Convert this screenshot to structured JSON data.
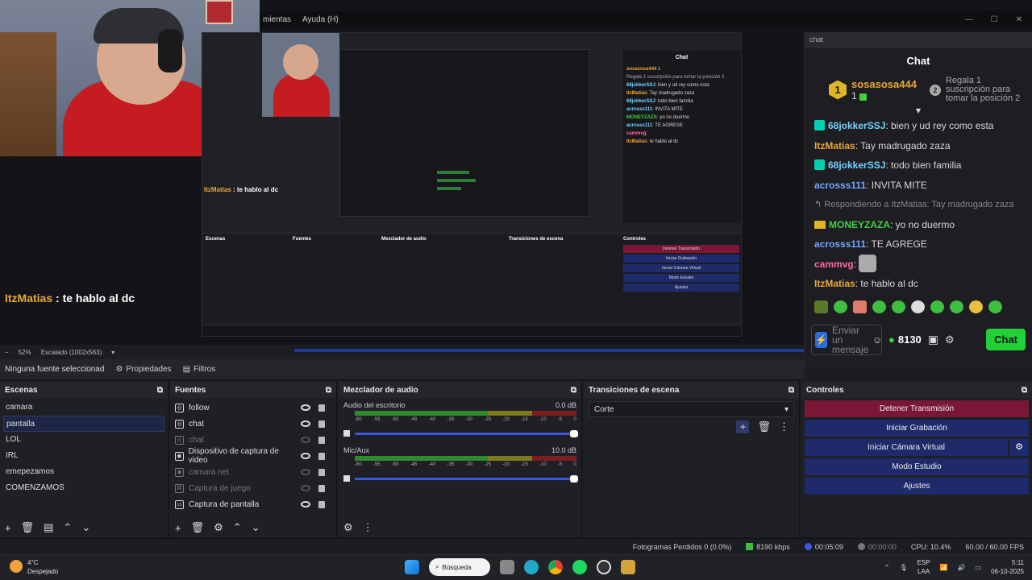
{
  "window": {
    "menu": [
      "mientas",
      "Ayuda (H)"
    ],
    "controls": [
      "—",
      "☐",
      "✕"
    ]
  },
  "inner_screen": {
    "chat_title": "Chat",
    "leader_name": "sosasosa444",
    "leader_count": "1",
    "regala": "Regala 1 suscripción para tomar la posición 2",
    "messages": [
      {
        "user": "68jokkerSSJ",
        "text": ": bien y ud rey como esta"
      },
      {
        "user": "ItzMatias",
        "text": ": Tay madrugado zaza"
      },
      {
        "user": "68jokkerSSJ",
        "text": ": todo bien familia"
      },
      {
        "user": "acrosss111",
        "text": ": INVITA MITE"
      },
      {
        "user": "MONEYZAZA",
        "text": ": yo no duermo"
      },
      {
        "user": "acrosss111",
        "text": ": TE AGREGE"
      },
      {
        "user": "cammvg",
        "text": ":"
      },
      {
        "user": "ItzMatias",
        "text": ": te hablo al dc"
      }
    ],
    "itz_line": {
      "user": "ItzMatias",
      "text": " : te hablo al dc"
    },
    "docks": [
      "Escenas",
      "Fuentes",
      "Mezclador de audio",
      "Transiciones de escena",
      "Controles"
    ],
    "buttons": [
      "Detener Transmisión",
      "Iniciar Grabación",
      "Iniciar Cámara Virtual",
      "Modo Estudio",
      "Ajustes"
    ]
  },
  "overlay": {
    "user": "ItzMatias",
    "text": " : te hablo al dc"
  },
  "chat": {
    "top_label": "chat",
    "title": "Chat",
    "leader": {
      "rank": "1",
      "name": "sosasosa444",
      "count": "1",
      "next_rank": "2",
      "hint": "Regala 1 suscripción para tomar la posición 2"
    },
    "messages": [
      {
        "type": "msg",
        "badge": true,
        "user": "68jokkerSSJ",
        "color": "#74d2ff",
        "text": ": bien y ud rey como esta"
      },
      {
        "type": "msg",
        "badge": false,
        "user": "ItzMatias",
        "color": "#e8a838",
        "text": ": Tay madrugado zaza"
      },
      {
        "type": "msg",
        "badge": true,
        "user": "68jokkerSSJ",
        "color": "#74d2ff",
        "text": ": todo bien familia"
      },
      {
        "type": "msg",
        "badge": false,
        "user": "acrosss111",
        "color": "#74a6ff",
        "text": ": INVITA MITE"
      },
      {
        "type": "reply",
        "text": "Respondiendo a ItzMatias: Tay madrugado zaza"
      },
      {
        "type": "msg",
        "crown": true,
        "user": "MONEYZAZA",
        "color": "#3fd13f",
        "text": ": yo no duermo"
      },
      {
        "type": "msg",
        "badge": false,
        "user": "acrosss111",
        "color": "#74a6ff",
        "text": ": TE AGREGE"
      },
      {
        "type": "msg",
        "badge": false,
        "user": "cammvg",
        "color": "#ff6b9d",
        "text": ":",
        "emote": true
      },
      {
        "type": "msg",
        "badge": false,
        "user": "ItzMatias",
        "color": "#e8a838",
        "text": ": te hablo al dc"
      }
    ],
    "input_placeholder": "Enviar un mensaje",
    "points": "8130",
    "send_label": "Chat",
    "accent": "#22d13a"
  },
  "zoom": {
    "value": "52%",
    "scaling": "Escalado (1002x563)"
  },
  "props": {
    "selection": "Ninguna fuente seleccionad",
    "properties_tab": "Propiedades",
    "filters_tab": "Filtros"
  },
  "scenes": {
    "title": "Escenas",
    "items": [
      "camara",
      "pantalla",
      "LOL",
      "IRL",
      "emepezamos",
      "COMENZAMOS"
    ],
    "selected": 1
  },
  "sources": {
    "title": "Fuentes",
    "items": [
      {
        "label": "follow",
        "icon": "globe-icon",
        "visible": true,
        "dim": false
      },
      {
        "label": "chat",
        "icon": "globe-icon",
        "visible": true,
        "dim": false
      },
      {
        "label": "chat",
        "icon": "globe-icon",
        "visible": false,
        "dim": true
      },
      {
        "label": "Dispositivo de captura de video",
        "icon": "camera-icon",
        "visible": true,
        "dim": false
      },
      {
        "label": "camara net",
        "icon": "camera-icon",
        "visible": false,
        "dim": true
      },
      {
        "label": "Captura de juego",
        "icon": "gamepad-icon",
        "visible": false,
        "dim": true
      },
      {
        "label": "Captura de pantalla",
        "icon": "monitor-icon",
        "visible": true,
        "dim": false
      }
    ]
  },
  "mixer": {
    "title": "Mezclador de audio",
    "channels": [
      {
        "name": "Audio del escritorio",
        "db": "0.0 dB"
      },
      {
        "name": "Mic/Aux",
        "db": "10.0 dB"
      }
    ],
    "ticks": [
      "-60",
      "-55",
      "-50",
      "-45",
      "-40",
      "-35",
      "-30",
      "-25",
      "-20",
      "-15",
      "-10",
      "-5",
      "0"
    ]
  },
  "transitions": {
    "title": "Transiciones de escena",
    "selected": "Corte"
  },
  "controls": {
    "title": "Controles",
    "stop": "Detener Transmisión",
    "record": "Iniciar Grabación",
    "virtual_cam": "Iniciar Cámara Virtual",
    "studio": "Modo Estudio",
    "settings": "Ajustes"
  },
  "status": {
    "dropped": "Fotogramas Perdidos 0 (0.0%)",
    "bitrate": "8190 kbps",
    "stream_time": "00:05:09",
    "rec_time": "00:00:00",
    "cpu": "CPU: 10.4%",
    "fps": "60.00 / 60.00 FPS"
  },
  "taskbar": {
    "temp": "4°C",
    "weather": "Despejado",
    "search": "Búsqueda",
    "lang1": "ESP",
    "lang2": "LAA",
    "time": "5:11",
    "date": "06-10-2025"
  }
}
